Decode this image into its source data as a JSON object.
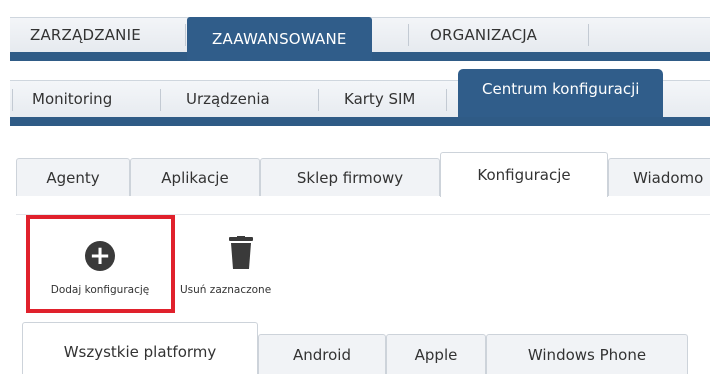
{
  "top_nav": {
    "items": [
      "ZARZĄDZANIE",
      "ZAAWANSOWANE",
      "ORGANIZACJA"
    ],
    "active_index": 1
  },
  "sub_nav": {
    "items": [
      "Monitoring",
      "Urządzenia",
      "Karty SIM",
      "Centrum konfiguracji"
    ],
    "active_index": 3
  },
  "section_tabs": {
    "items": [
      "Agenty",
      "Aplikacje",
      "Sklep firmowy",
      "Konfiguracje",
      "Wiadomo"
    ],
    "active_index": 3
  },
  "toolbar": {
    "add_label": "Dodaj konfigurację",
    "delete_label": "Usuń zaznaczone",
    "add_icon": "plus-circle-icon",
    "delete_icon": "trash-icon",
    "highlight_color": "#e0212c"
  },
  "platform_tabs": {
    "items": [
      "Wszystkie platformy",
      "Android",
      "Apple",
      "Windows Phone"
    ],
    "active_index": 0
  },
  "colors": {
    "nav_blue": "#305d8a"
  }
}
